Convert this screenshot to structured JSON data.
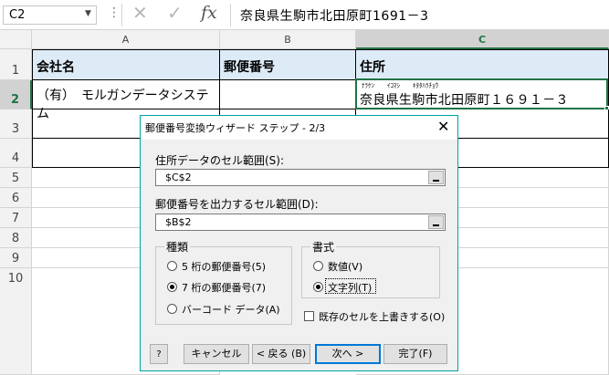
{
  "formula_bar": {
    "name_box": "C2",
    "dots": "⋮",
    "formula": "奈良県生駒市北田原町1691－3"
  },
  "columns": [
    "A",
    "B",
    "C"
  ],
  "rows": [
    "1",
    "2",
    "3",
    "4",
    "5",
    "6",
    "7",
    "8",
    "9",
    "10"
  ],
  "cells": {
    "a1": "会社名",
    "b1": "郵便番号",
    "c1": "住所",
    "a2": "（有）　モルガンデータシステム",
    "c2_furigana": "ﾅﾗｹﾝ　　ｲｺﾏｼ　　ｷﾀﾀﾊﾗﾁｮｳ",
    "c2": "奈良県生駒市北田原町１６９１－３"
  },
  "dialog": {
    "title": "郵便番号変換ウィザード ステップ - 2/3",
    "close": "✕",
    "address_range_label": "住所データのセル範囲(S):",
    "address_range_value": "$C$2",
    "output_range_label": "郵便番号を出力するセル範囲(D):",
    "output_range_value": "$B$2",
    "type_group": {
      "title": "種類",
      "options": [
        "5 桁の郵便番号(5)",
        "7 桁の郵便番号(7)",
        "バーコード データ(A)"
      ],
      "selected_index": 1
    },
    "format_group": {
      "title": "書式",
      "options": [
        "数値(V)",
        "文字列(T)"
      ],
      "selected_index": 1
    },
    "overwrite_label": "既存のセルを上書きする(O)",
    "overwrite_checked": false,
    "buttons": {
      "cancel": "キャンセル",
      "back": "< 戻る (B)",
      "next": "次へ >",
      "finish": "完了(F)"
    }
  }
}
